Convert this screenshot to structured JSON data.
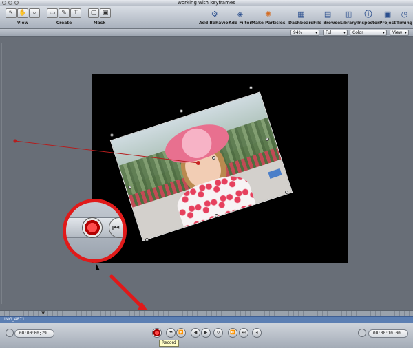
{
  "window": {
    "title": "working with keyframes"
  },
  "toolbar": {
    "groups": [
      {
        "label": "View"
      },
      {
        "label": "Create"
      },
      {
        "label": "Mask"
      }
    ],
    "right_tools": [
      {
        "label": "Add Behavior",
        "icon": "gear-icon"
      },
      {
        "label": "Add Filter",
        "icon": "filter-icon"
      },
      {
        "label": "Make Particles",
        "icon": "particles-icon"
      },
      {
        "label": "Dashboard",
        "icon": "dashboard-icon"
      },
      {
        "label": "File Browser",
        "icon": "file-browser-icon"
      },
      {
        "label": "Library",
        "icon": "library-icon"
      },
      {
        "label": "Inspector",
        "icon": "inspector-icon"
      },
      {
        "label": "Project",
        "icon": "project-icon"
      },
      {
        "label": "Timing",
        "icon": "timing-icon"
      }
    ]
  },
  "viewbar": {
    "zoom": "94%",
    "resolution": "Full",
    "channels": "Color",
    "view": "View"
  },
  "timeline": {
    "clip_name": "IMG_4871"
  },
  "transport": {
    "current_time": "00:00:00;29",
    "duration": "00:00:10;00",
    "tooltip": "Record"
  }
}
